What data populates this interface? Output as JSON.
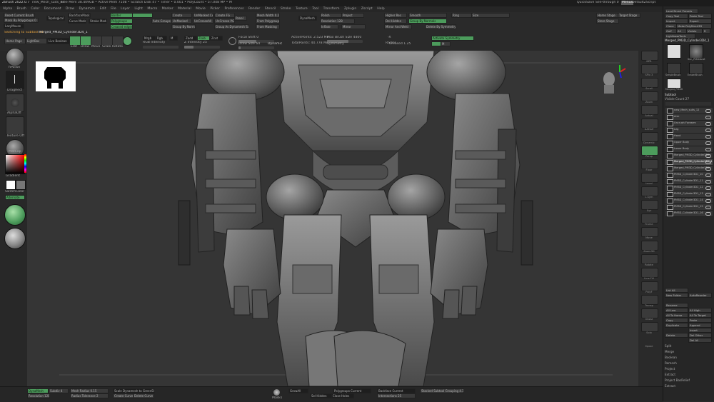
{
  "titlebar": {
    "app": "ZBrush 2022.0.7",
    "doc": "new_Mech_suits_43",
    "stats": "Free Mem 38.409GB • Active Mem 7108 • Scratch Disk 47 • Timer • 0.001 • PolyCount • 57.048 MP • MeshCount • 27",
    "quicksave": "QuickSave",
    "seethrough": "See-through 0",
    "menus_btn": "Menus",
    "script": "DefaultZScript"
  },
  "menubar": [
    "Alpha",
    "Brush",
    "Color",
    "Document",
    "Draw",
    "Dynamics",
    "Edit",
    "File",
    "Layer",
    "Light",
    "Macro",
    "Marker",
    "Material",
    "Movie",
    "Picker",
    "Preferences",
    "Render",
    "Stencil",
    "Stroke",
    "Texture",
    "Tool",
    "Transform",
    "Zplugin",
    "Zscript",
    "Help"
  ],
  "topstrip": {
    "reset_brush": "Reset Current Brush",
    "mask_polygroups": "Mask By Polygroups 0",
    "lazymouse": "LazyMouse",
    "topological": "Topological",
    "backface_mask": "BackfaceMask",
    "curve_mode": "Curve Mode",
    "stroke_mode": "Stroke Mode",
    "border": "Border",
    "polygroups": "Polygroups",
    "creased_edges": "Creased edges",
    "create": "Create",
    "unmasked": "UnMasked",
    "unmasked_center": "UnMasked Center",
    "groups_split": "Groups Split",
    "auto_groups": "Auto Groups",
    "group_by_normals": "Group By Normals",
    "create_fg": "Create FG",
    "uncreased": "UnCreaseAll",
    "uncrease_pg": "UnCrease PG",
    "group_optimize": "Group As Dynamesh Sub",
    "panel": "Panel",
    "mesh_width": "Mesh Width 0.25",
    "from_polygroups": "From Polygroups",
    "from_masking": "From Masking",
    "dynamesh": "DynaMesh",
    "groups": "Groups",
    "polish": "Polish",
    "project": "Project",
    "resolution": "Resolution 128",
    "blur": "Blur 2",
    "subdiv": "Subdiv 0",
    "inflate": "Inflate",
    "higher_res": "Higher Res",
    "mirror": "Mirror",
    "mirror_weld": "Mirror And Weld",
    "del_hidden": "Del Hidden",
    "smooth": "Smooth",
    "group_by_normals2": "Group By Normals",
    "delete_by_symmetry": "Delete By Symmetry",
    "ring": "Ring",
    "size": "Size",
    "home_stage": "Home Stage",
    "target_stage": "Target Stage",
    "store_stage": "Store Stage"
  },
  "toolbar2": {
    "switching_label": "Switching to Subtool 34:",
    "merged_name": "Merged_PM3D_Cylinder3D4_1",
    "home_page": "Home Page",
    "lightbox": "LightBox",
    "live_boolean": "Live Boolean",
    "edit": "Edit",
    "draw": "Draw",
    "move": "Move",
    "scale": "Scale",
    "rotate": "Rotate",
    "mrgb": "Mrgb",
    "rgb": "Rgb",
    "m": "M",
    "zadd": "Zadd",
    "zsub": "Zsub",
    "zcut": "Zcut",
    "rgb_intensity": "RGB Intensity",
    "z_intensity": "Z Intensity 25",
    "focal_shift": "Focal Shift 0",
    "draw_size": "Draw Size 64",
    "dynamic": "Dynamic",
    "active_points": "ActivePoints: 2.523 Mil",
    "total_points": "TotalPoints: 40.778 Mil",
    "max_brush_size": "Max Brush Size 4400",
    "symmetry": "Symmetry",
    "x_sym": "-X",
    "local_sym": "Activate Symmetry",
    "m_btn": "M",
    "radial": "Radial",
    "creased": "Creased 1.25"
  },
  "lefttray": {
    "hpolish": "hPolish",
    "dragrect": "DragRect",
    "alpha_off": "AlphaOff",
    "texture_off": "Texture Off",
    "matcap": "MatCap",
    "gradient": "Gradient",
    "switch_color": "SwitchColor",
    "alternate": "Alternate",
    "intensity": "Gradient"
  },
  "righticons": [
    "BPR",
    "SPix 3",
    "Scroll",
    "Zoom",
    "Actual",
    "AAHalf",
    "Dynamic",
    "Persp",
    "Floor",
    "Local",
    "L.Sym",
    "Xyz",
    "Frame",
    "Move",
    "Zoom3D",
    "Rotate",
    "Line Fill",
    "PolyF",
    "Transp",
    "Ghost",
    "Solo",
    "Xpose"
  ],
  "rightpanel": {
    "load_brush": "Load Brush Presets",
    "copy_tool": "Copy Tool",
    "paste_tool": "Paste Tool",
    "import": "Import",
    "export": "Export",
    "clone": "Clone",
    "make_polymesh": "Make PolyMesh3D",
    "goz": "GoZ",
    "all": "All",
    "visible": "Visible",
    "r": "R",
    "lightbox_tools": "Lightbox▸Tools",
    "merged_title": "Merged_PM3D_Cylinder3D4_1",
    "tools": [
      "Merged_PM3D",
      "Sim_PM3Dbrst",
      "SimpleBrush",
      "EraserBrush",
      "Merged_PM3D"
    ],
    "subtool_header": "Subtool",
    "visible_count": "Visible Count 27",
    "subtools": [
      "new_Mech_suits_12",
      "Arm",
      "Uncrush Forearm",
      "Leg",
      "Hand",
      "Upper Body",
      "Lower Body",
      "Merged_PM3D_Cylinder3D4",
      "Merged_PM3D_Cylinder3D4_1",
      "Merged_PM3D_Cylinder3D4",
      "PM3D_Cylinder3D1_10",
      "PM3D_Cylinder3D1_11",
      "PM3D_Cylinder3D1_12",
      "PM3D_Cylinder3D1_13",
      "PM3D_Cylinder3D1_14",
      "PM3D_Cylinder3D1_15",
      "PM3D_Cylinder3D1_16"
    ],
    "list_all": "List All",
    "new_folder": "New Folder",
    "auto_reorder": "AutoReorder",
    "rename": "Rename",
    "all_low": "All Low",
    "all_high": "All High",
    "all_to_home": "All To Home",
    "all_to_target": "All To Target",
    "copy": "Copy",
    "paste": "Paste",
    "duplicate": "Duplicate",
    "append": "Append",
    "insert": "Insert",
    "delete": "Delete",
    "del_other": "Del Other",
    "del_all": "Del All",
    "split": "Split",
    "merge": "Merge",
    "boolean": "Boolean",
    "remesh": "Remesh",
    "project": "Project",
    "extract": "Extract",
    "project_bas_relief": "Project BasRelief",
    "extract2": "Extract"
  },
  "bottombar": {
    "dynamesh": "DynaMesh",
    "resolution": "Resolution 128",
    "subdiv": "Subdiv 4",
    "mesh_radius": "Mesh Radius 0.15",
    "radius_tolerance": "Radius Tolerance 2",
    "scale_dynamesh": "Scale Dynamesh to GreenSlice",
    "create_curve": "Create Curve",
    "delete_curve": "Delete Curve",
    "masks": "Masks",
    "grow_all": "GrowAll",
    "sel_hidden": "Sel Hidden",
    "close_holes": "Close Holes",
    "polygroups_current": "Polygroups Current",
    "backface_current": "Backface Current",
    "intersections": "Intersections 25",
    "stacked": "Stacked Subtool Grouping 4.35"
  }
}
